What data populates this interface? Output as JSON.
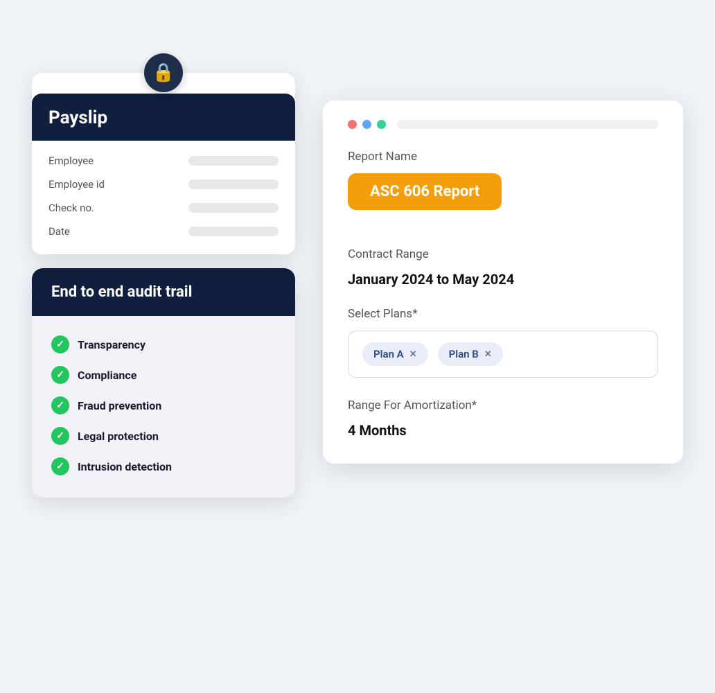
{
  "payslip": {
    "title": "Payslip",
    "lock_icon": "🔒",
    "fields": [
      {
        "label": "Employee"
      },
      {
        "label": "Employee id"
      },
      {
        "label": "Check no."
      },
      {
        "label": "Date"
      }
    ]
  },
  "audit_trail": {
    "title": "End to end audit trail",
    "items": [
      {
        "text": "Transparency"
      },
      {
        "text": "Compliance"
      },
      {
        "text": "Fraud prevention"
      },
      {
        "text": "Legal protection"
      },
      {
        "text": "Intrusion detection"
      }
    ]
  },
  "report": {
    "report_name_label": "Report Name",
    "report_name_value": "ASC 606 Report",
    "contract_range_label": "Contract Range",
    "contract_range_value": "January 2024 to May 2024",
    "select_plans_label": "Select Plans*",
    "plans": [
      {
        "name": "Plan A"
      },
      {
        "name": "Plan B"
      }
    ],
    "amortization_label": "Range For Amortization*",
    "amortization_value": "4 Months"
  },
  "colors": {
    "dark_navy": "#0f1f3d",
    "amber": "#f59e0b",
    "green_check": "#22c55e",
    "white": "#ffffff"
  }
}
